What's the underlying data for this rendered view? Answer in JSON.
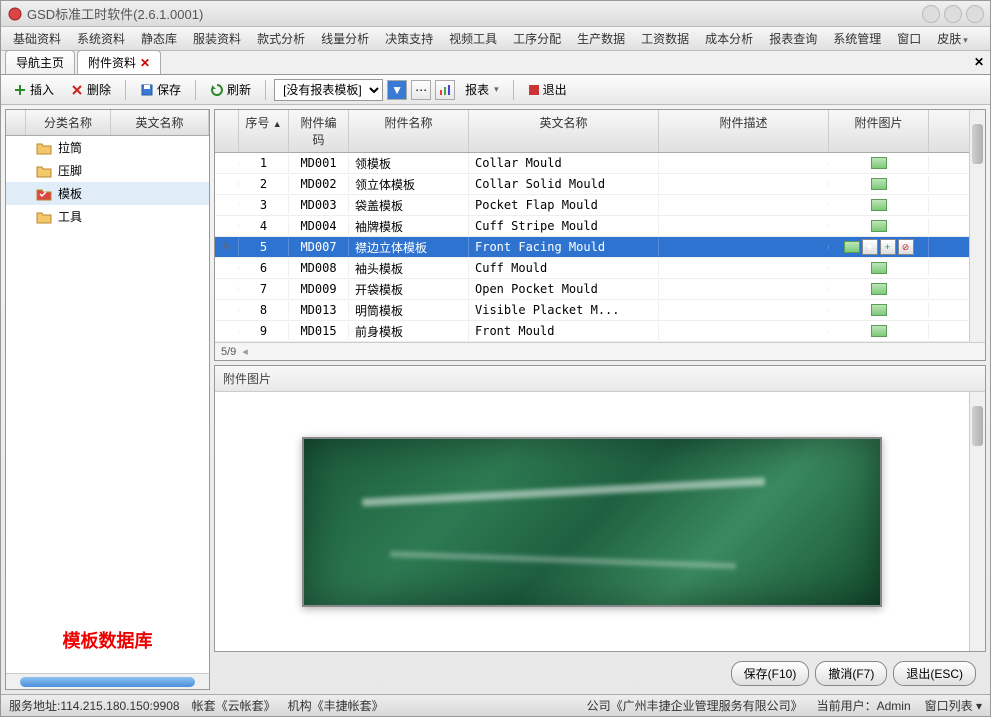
{
  "title": "GSD标准工时软件(2.6.1.0001)",
  "menus": [
    "基础资料",
    "系统资料",
    "静态库",
    "服装资料",
    "款式分析",
    "线量分析",
    "决策支持",
    "视频工具",
    "工序分配",
    "生产数据",
    "工资数据",
    "成本分析",
    "报表查询",
    "系统管理",
    "窗口",
    "皮肤"
  ],
  "tabs": {
    "main": "导航主页",
    "active": "附件资料"
  },
  "toolbar": {
    "insert": "插入",
    "delete": "删除",
    "save": "保存",
    "refresh": "刷新",
    "template_none": "[没有报表模板]",
    "report": "报表",
    "exit": "退出"
  },
  "tree": {
    "headers": [
      "",
      "分类名称",
      "英文名称"
    ],
    "items": [
      {
        "label": "拉筒",
        "icon": "folder"
      },
      {
        "label": "压脚",
        "icon": "folder"
      },
      {
        "label": "模板",
        "icon": "folder-check",
        "selected": true
      },
      {
        "label": "工具",
        "icon": "folder"
      }
    ],
    "footer_title": "模板数据库"
  },
  "grid": {
    "headers": {
      "seq": "序号",
      "code": "附件编码",
      "name": "附件名称",
      "ename": "英文名称",
      "desc": "附件描述",
      "pic": "附件图片"
    },
    "rows": [
      {
        "seq": "1",
        "code": "MD001",
        "name": "领模板",
        "ename": "Collar Mould"
      },
      {
        "seq": "2",
        "code": "MD002",
        "name": "领立体模板",
        "ename": "Collar Solid Mould"
      },
      {
        "seq": "3",
        "code": "MD003",
        "name": "袋盖模板",
        "ename": "Pocket Flap Mould"
      },
      {
        "seq": "4",
        "code": "MD004",
        "name": "袖牌模板",
        "ename": "Cuff Stripe Mould"
      },
      {
        "seq": "5",
        "code": "MD007",
        "name": "襟边立体模板",
        "ename": "Front Facing Mould",
        "selected": true
      },
      {
        "seq": "6",
        "code": "MD008",
        "name": "袖头模板",
        "ename": "Cuff Mould"
      },
      {
        "seq": "7",
        "code": "MD009",
        "name": "开袋模板",
        "ename": "Open Pocket Mould"
      },
      {
        "seq": "8",
        "code": "MD013",
        "name": "明筒模板",
        "ename": "Visible Placket M..."
      },
      {
        "seq": "9",
        "code": "MD015",
        "name": "前身模板",
        "ename": "Front Mould"
      }
    ],
    "footer": "5/9"
  },
  "preview": {
    "title": "附件图片"
  },
  "actions": {
    "save": "保存(F10)",
    "cancel": "撤消(F7)",
    "exit": "退出(ESC)"
  },
  "status": {
    "server": "服务地址:114.215.180.150:9908",
    "account": "帐套《云帐套》",
    "org": "机构《丰捷帐套》",
    "company": "公司《广州丰捷企业管理服务有限公司》",
    "user": "当前用户：Admin",
    "winlist": "窗口列表"
  }
}
